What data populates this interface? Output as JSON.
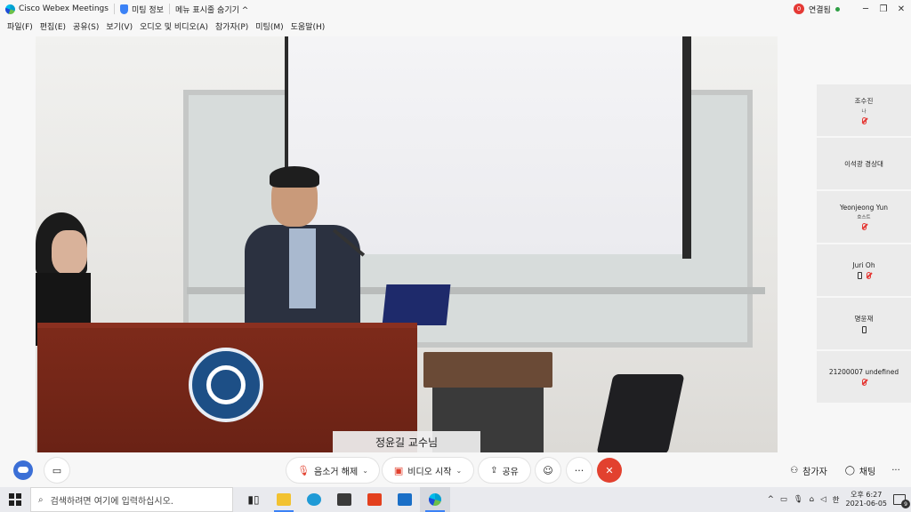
{
  "titlebar": {
    "app_title": "Cisco Webex Meetings",
    "meeting_info": "미팅 정보",
    "hide_menu": "메뉴 표시줄 숨기기 ^",
    "connection_badge": "0",
    "connection_label": "연결됨",
    "minimize": "─",
    "maximize": "❐",
    "close": "✕"
  },
  "menubar": {
    "items": [
      "파일(F)",
      "편집(E)",
      "공유(S)",
      "보기(V)",
      "오디오 및 비디오(A)",
      "참가자(P)",
      "미팅(M)",
      "도움말(H)"
    ]
  },
  "video": {
    "speaker_name": "정윤길 교수님"
  },
  "participants": [
    {
      "name": "조수진",
      "role": "나",
      "muted": true,
      "phone": false
    },
    {
      "name": "이석광 경상대",
      "role": "",
      "muted": false,
      "phone": false
    },
    {
      "name": "Yeonjeong Yun",
      "role": "호스트",
      "muted": true,
      "phone": false
    },
    {
      "name": "Juri Oh",
      "role": "",
      "muted": true,
      "phone": true
    },
    {
      "name": "명윤재",
      "role": "",
      "muted": false,
      "phone": true
    },
    {
      "name": "21200007 undefined",
      "role": "",
      "muted": true,
      "phone": false
    }
  ],
  "controls": {
    "unmute": "음소거 해제",
    "start_video": "비디오 시작",
    "share": "공유",
    "reactions_icon": "☺",
    "more": "···",
    "leave_icon": "✕",
    "participants": "참가자",
    "chat": "채팅",
    "more_right": "···"
  },
  "taskbar": {
    "search_placeholder": "검색하려면 여기에 입력하십시오.",
    "time": "오후 6:27",
    "date": "2021-06-05",
    "ime": "한",
    "notification_count": "9"
  }
}
